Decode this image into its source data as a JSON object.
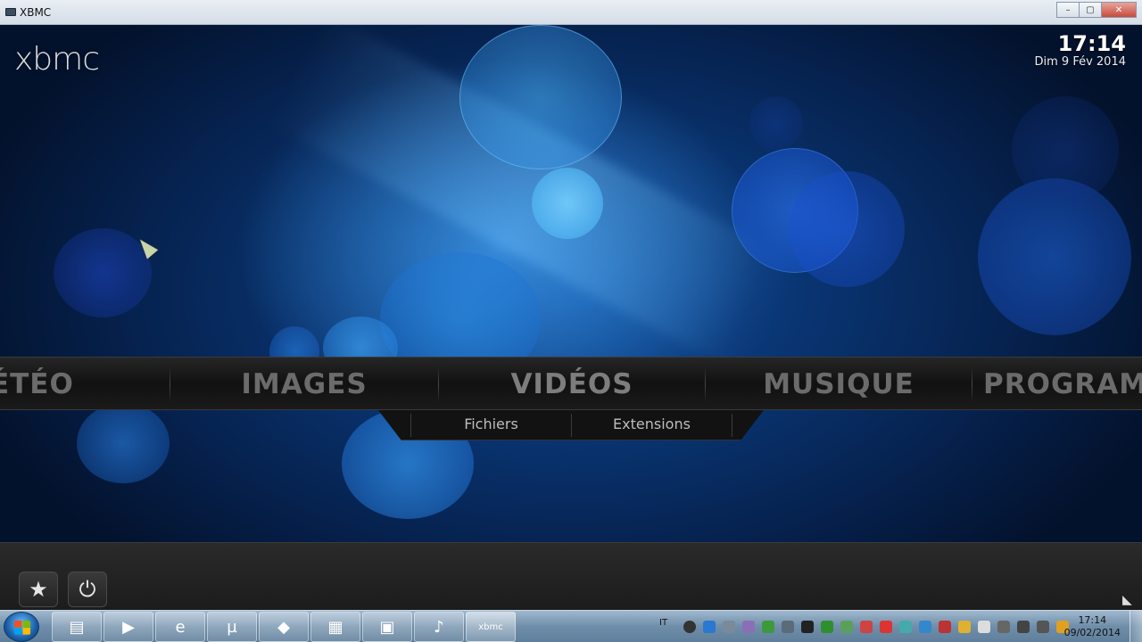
{
  "window": {
    "title": "XBMC",
    "minimize_glyph": "–",
    "maximize_glyph": "▢",
    "close_glyph": "✕"
  },
  "xbmc": {
    "logo_text": "xbmc",
    "clock": {
      "time": "17:14",
      "date": "Dim 9 Fév 2014"
    },
    "main_menu": [
      {
        "label": "MÉTÉO"
      },
      {
        "label": "IMAGES"
      },
      {
        "label": "VIDÉOS",
        "selected": true
      },
      {
        "label": "MUSIQUE"
      },
      {
        "label": "PROGRAMMES"
      }
    ],
    "sub_menu": [
      {
        "label": "Fichiers"
      },
      {
        "label": "Extensions"
      }
    ],
    "bottom_buttons": [
      {
        "icon": "star-icon",
        "glyph": "★"
      },
      {
        "icon": "power-icon",
        "glyph": "⏻"
      }
    ],
    "rss_icon": "rss-icon",
    "rss_glyph": "◣"
  },
  "taskbar": {
    "pinned": [
      {
        "icon": "file-explorer-icon",
        "glyph": "▤"
      },
      {
        "icon": "media-player-icon",
        "glyph": "▶"
      },
      {
        "icon": "internet-explorer-icon",
        "glyph": "e"
      },
      {
        "icon": "utorrent-icon",
        "glyph": "µ"
      },
      {
        "icon": "app-cube-icon",
        "glyph": "◆"
      },
      {
        "icon": "control-panel-icon",
        "glyph": "▦"
      },
      {
        "icon": "video-app-icon",
        "glyph": "▣"
      },
      {
        "icon": "music-note-icon",
        "glyph": "♪"
      },
      {
        "icon": "xbmc-taskbar-icon",
        "glyph": "xbmc",
        "active": true
      }
    ],
    "tray_language": "IT",
    "tray_time": "17:14",
    "tray_date": "09/02/2014"
  },
  "colors": {
    "menu_text": "#6b6b6b",
    "menu_bar": "#1a1a1a",
    "background_blue": "#0d4a9a",
    "taskbar": "#6f8ea9"
  }
}
